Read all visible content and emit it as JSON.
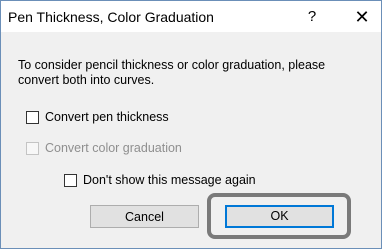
{
  "window": {
    "title": "Pen Thickness, Color Graduation",
    "help_icon_glyph": "?",
    "close_icon_glyph": "✕"
  },
  "message": "To consider pencil thickness or color graduation, please convert both into curves.",
  "checkboxes": [
    {
      "label": "Convert pen thickness",
      "checked": false,
      "enabled": true
    },
    {
      "label": "Convert color graduation",
      "checked": false,
      "enabled": false
    },
    {
      "label": "Don't show this message again",
      "checked": false,
      "enabled": true
    }
  ],
  "buttons": {
    "cancel_label": "Cancel",
    "ok_label": "OK"
  },
  "colors": {
    "accent": "#0078d7",
    "highlight": "#7a7a7a",
    "window_bg": "#f0f0f0"
  }
}
